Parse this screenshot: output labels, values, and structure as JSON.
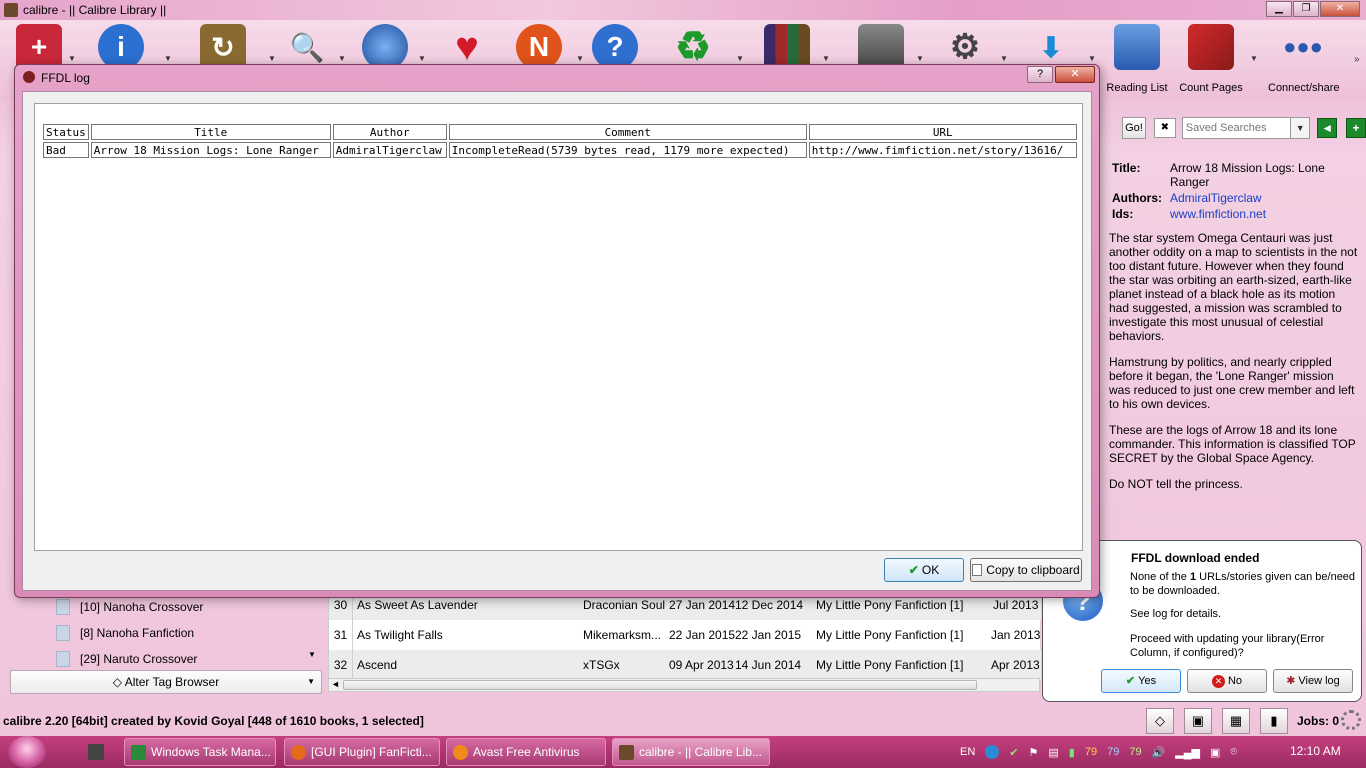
{
  "window": {
    "title": "calibre - || Calibre Library ||"
  },
  "toolbar": {
    "items": [
      {
        "icon": "add-books-icon",
        "label": ""
      },
      {
        "icon": "edit-metadata-icon",
        "label": ""
      },
      {
        "icon": "convert-books-icon",
        "label": ""
      },
      {
        "icon": "view-icon",
        "label": ""
      },
      {
        "icon": "get-books-icon",
        "label": ""
      },
      {
        "icon": "heart-icon",
        "label": ""
      },
      {
        "icon": "news-icon",
        "label": ""
      },
      {
        "icon": "help-icon",
        "label": ""
      },
      {
        "icon": "remove-books-icon",
        "label": ""
      },
      {
        "icon": "library-icon",
        "label": ""
      },
      {
        "icon": "device-icon",
        "label": ""
      },
      {
        "icon": "preferences-icon",
        "label": ""
      },
      {
        "icon": "ffdl-icon",
        "label": ""
      },
      {
        "icon": "reading-list-icon",
        "label": "Reading List"
      },
      {
        "icon": "count-pages-icon",
        "label": "Count Pages"
      },
      {
        "icon": "connect-share-icon",
        "label": "Connect/share"
      }
    ]
  },
  "search": {
    "go_label": "Go!",
    "saved_searches_placeholder": "Saved Searches"
  },
  "details": {
    "title_key": "Title:",
    "title_value": "Arrow 18 Mission Logs: Lone Ranger",
    "authors_key": "Authors:",
    "authors_value": "AdmiralTigerclaw",
    "ids_key": "Ids:",
    "ids_value": "www.fimfiction.net",
    "comments": [
      "The star system Omega Centauri was just another oddity on a map to scientists in the not too distant future. However when they found the star was orbiting an earth-sized, earth-like planet instead of a black hole as its motion had suggested, a mission was scrambled to investigate this most unusual of celestial behaviors.",
      "Hamstrung by politics, and nearly crippled before it began, the 'Lone Ranger' mission was reduced to just one crew member and left to his own devices.",
      "These are the logs of Arrow 18 and its lone commander. This information is classified TOP SECRET by the Global Space Agency.",
      "Do NOT tell the princess."
    ]
  },
  "tags": {
    "items": [
      "[10] Nanoha Crossover",
      "[8] Nanoha Fanfiction",
      "[29] Naruto Crossover"
    ],
    "alter_label": "Alter Tag Browser"
  },
  "books": {
    "rows": [
      {
        "num": "30",
        "title": "As Sweet As Lavender",
        "author": "Draconian Soul",
        "date": "27 Jan 2014",
        "modified": "12 Dec 2014",
        "series": "My Little Pony Fanfiction [1]",
        "published": "Jul 2013"
      },
      {
        "num": "31",
        "title": "As Twilight Falls",
        "author": "Mikemarksm...",
        "date": "22 Jan 2015",
        "modified": "22 Jan 2015",
        "series": "My Little Pony Fanfiction [1]",
        "published": "Jan 2013"
      },
      {
        "num": "32",
        "title": "Ascend",
        "author": "xTSGx",
        "date": "09 Apr 2013",
        "modified": "14 Jun 2014",
        "series": "My Little Pony Fanfiction [1]",
        "published": "Apr 2013"
      }
    ]
  },
  "status": {
    "text": "calibre 2.20 [64bit] created by Kovid Goyal    [448 of 1610 books, 1 selected]",
    "jobs": "Jobs: 0"
  },
  "notification": {
    "title": "FFDL download ended",
    "msg_pre": "None of the ",
    "msg_count": "1",
    "msg_post": " URLs/stories given can be/need to be downloaded.",
    "msg_log": "See log for details.",
    "msg_proceed": "Proceed with updating your library(Error Column, if configured)?",
    "yes": "Yes",
    "no": "No",
    "view_log": "View log"
  },
  "dialog": {
    "title": "FFDL log",
    "help": "?",
    "close": "✕",
    "headers": [
      "Status",
      "Title",
      "Author",
      "Comment",
      "URL"
    ],
    "row": [
      "Bad",
      "Arrow 18 Mission Logs: Lone Ranger",
      "AdmiralTigerclaw",
      "IncompleteRead(5739 bytes read, 1179 more expected)",
      "http://www.fimfiction.net/story/13616/"
    ],
    "ok": "OK",
    "copy": "Copy to clipboard"
  },
  "taskbar": {
    "tasks": [
      "Windows Task Mana...",
      "[GUI Plugin] FanFicti...",
      "Avast Free Antivirus",
      "calibre - || Calibre Lib..."
    ],
    "lang": "EN",
    "temps": [
      "79",
      "79",
      "79"
    ],
    "clock": "12:10 AM"
  },
  "colors": {
    "accent": "#d98ab6",
    "link": "#1a40c8"
  }
}
